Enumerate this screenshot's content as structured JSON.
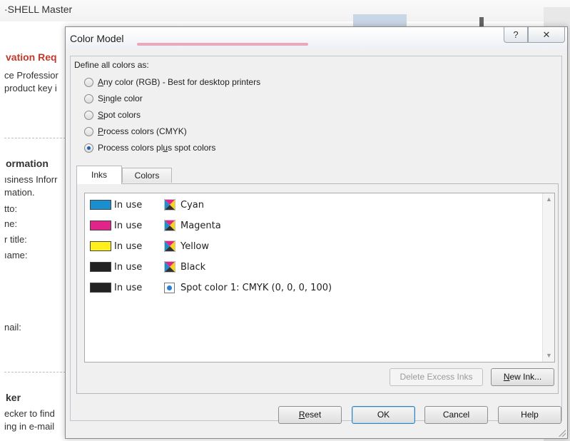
{
  "background": {
    "window_title": "·SHELL Master",
    "left_panel": {
      "heading_red": "vation Req",
      "line1": "ce Professior",
      "line2": "product key i",
      "section_heading": "ormation",
      "field_lines": [
        "ısiness Inforr",
        "mation.",
        "tto:",
        "ne:",
        "r title:",
        "ıame:"
      ],
      "email_label": "nail:",
      "checker_heading": "ker",
      "checker_lines": [
        "ecker to find",
        "ing in e-mail"
      ]
    }
  },
  "dialog": {
    "title": "Color Model",
    "help_button": "?",
    "close_button": "✕",
    "define_label": "Define all colors as:",
    "options": [
      {
        "pre": "",
        "key": "A",
        "post": "ny color (RGB) - Best for desktop printers",
        "checked": false
      },
      {
        "pre": "S",
        "key": "i",
        "post": "ngle color",
        "checked": false
      },
      {
        "pre": "",
        "key": "S",
        "post": "pot colors",
        "checked": false
      },
      {
        "pre": "",
        "key": "P",
        "post": "rocess colors (CMYK)",
        "checked": false
      },
      {
        "pre": "Process colors pl",
        "key": "u",
        "post": "s spot colors",
        "checked": true
      }
    ],
    "tabs": {
      "inks": "Inks",
      "colors": "Colors"
    },
    "inks": [
      {
        "swatch_color": "#1a8fd0",
        "status": "In use",
        "icon": "cmyk-icon",
        "name": "Cyan"
      },
      {
        "swatch_color": "#e0248a",
        "status": "In use",
        "icon": "cmyk-icon",
        "name": "Magenta"
      },
      {
        "swatch_color": "#ffef1a",
        "status": "In use",
        "icon": "cmyk-icon",
        "name": "Yellow"
      },
      {
        "swatch_color": "#222222",
        "status": "In use",
        "icon": "cmyk-icon",
        "name": "Black"
      },
      {
        "swatch_color": "#222222",
        "status": "In use",
        "icon": "spot-color-icon",
        "name": "Spot color 1: CMYK (0, 0, 0, 100)"
      }
    ],
    "buttons": {
      "delete_excess": "Delete Excess Inks",
      "new_ink_key": "N",
      "new_ink_rest": "ew Ink...",
      "reset_key": "R",
      "reset_rest": "eset",
      "ok": "OK",
      "cancel": "Cancel",
      "help": "Help"
    }
  }
}
